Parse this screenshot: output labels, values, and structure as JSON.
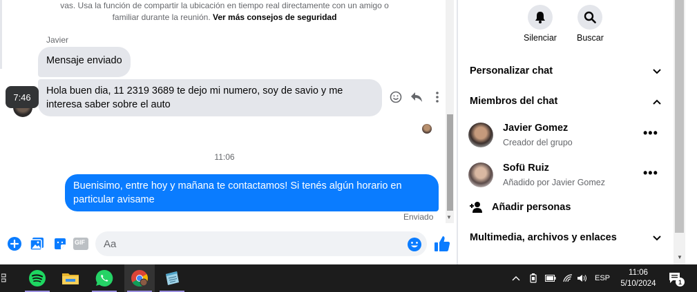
{
  "chat": {
    "safety_text": "vas. Usa la función de compartir la ubicación en tiempo real directamente con un amigo o familiar durante la reunión.",
    "safety_link": "Ver más consejos de seguridad",
    "sender_name": "Javier",
    "messages": [
      {
        "text": "Mensaje enviado",
        "direction": "incoming"
      },
      {
        "text": "Hola buen dia, 11 2319 3689 te dejo mi numero, soy de savio y me interesa saber sobre el auto",
        "direction": "incoming"
      },
      {
        "text": "Buenisimo, entre hoy y mañana te contactamos! Si tenés algún horario en particular avisame",
        "direction": "outgoing"
      }
    ],
    "tooltip_time": "7:46",
    "divider_time": "11:06",
    "sent_status": "Enviado"
  },
  "composer": {
    "placeholder": "Aa",
    "gif_label": "GIF"
  },
  "info_panel": {
    "actions": [
      {
        "label": "Silenciar",
        "icon": "bell-icon"
      },
      {
        "label": "Buscar",
        "icon": "search-icon"
      }
    ],
    "sections": {
      "customize": "Personalizar chat",
      "members": "Miembros del chat",
      "media": "Multimedia, archivos y enlaces"
    },
    "members": [
      {
        "name": "Javier Gomez",
        "subtitle": "Creador del grupo"
      },
      {
        "name": "Sofü Ruiz",
        "subtitle": "Añadido por Javier Gomez"
      }
    ],
    "add_people": "Añadir personas"
  },
  "taskbar": {
    "language": "ESP",
    "time": "11:06",
    "date": "5/10/2024",
    "notification_count": "1"
  },
  "colors": {
    "messenger_blue": "#0a7cff",
    "bubble_gray": "#e4e6eb",
    "taskbar": "#1c1c1c"
  }
}
